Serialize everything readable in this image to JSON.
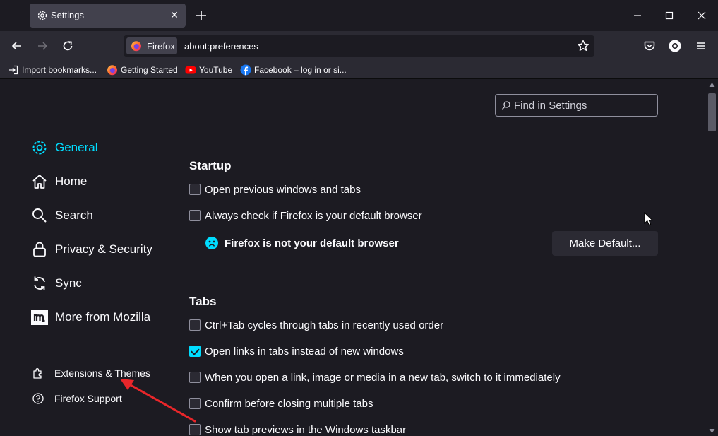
{
  "tab": {
    "title": "Settings"
  },
  "urlbar": {
    "identity_label": "Firefox",
    "url": "about:preferences"
  },
  "bookmarks": [
    {
      "label": "Import bookmarks..."
    },
    {
      "label": "Getting Started"
    },
    {
      "label": "YouTube"
    },
    {
      "label": "Facebook – log in or si..."
    }
  ],
  "search": {
    "placeholder": "Find in Settings"
  },
  "sidebar": {
    "items": [
      {
        "label": "General"
      },
      {
        "label": "Home"
      },
      {
        "label": "Search"
      },
      {
        "label": "Privacy & Security"
      },
      {
        "label": "Sync"
      },
      {
        "label": "More from Mozilla"
      }
    ],
    "footer": [
      {
        "label": "Extensions & Themes"
      },
      {
        "label": "Firefox Support"
      }
    ]
  },
  "startup": {
    "title": "Startup",
    "options": [
      {
        "label": "Open previous windows and tabs",
        "checked": false
      },
      {
        "label": "Always check if Firefox is your default browser",
        "checked": false
      }
    ],
    "not_default_text": "Firefox is not your default browser",
    "make_default_label": "Make Default..."
  },
  "tabs_section": {
    "title": "Tabs",
    "options": [
      {
        "label": "Ctrl+Tab cycles through tabs in recently used order",
        "checked": false
      },
      {
        "label": "Open links in tabs instead of new windows",
        "checked": true
      },
      {
        "label": "When you open a link, image or media in a new tab, switch to it immediately",
        "checked": false
      },
      {
        "label": "Confirm before closing multiple tabs",
        "checked": false
      },
      {
        "label": "Show tab previews in the Windows taskbar",
        "checked": false
      }
    ]
  },
  "colors": {
    "accent": "#00ddff",
    "annotation_arrow": "#e8262a"
  }
}
